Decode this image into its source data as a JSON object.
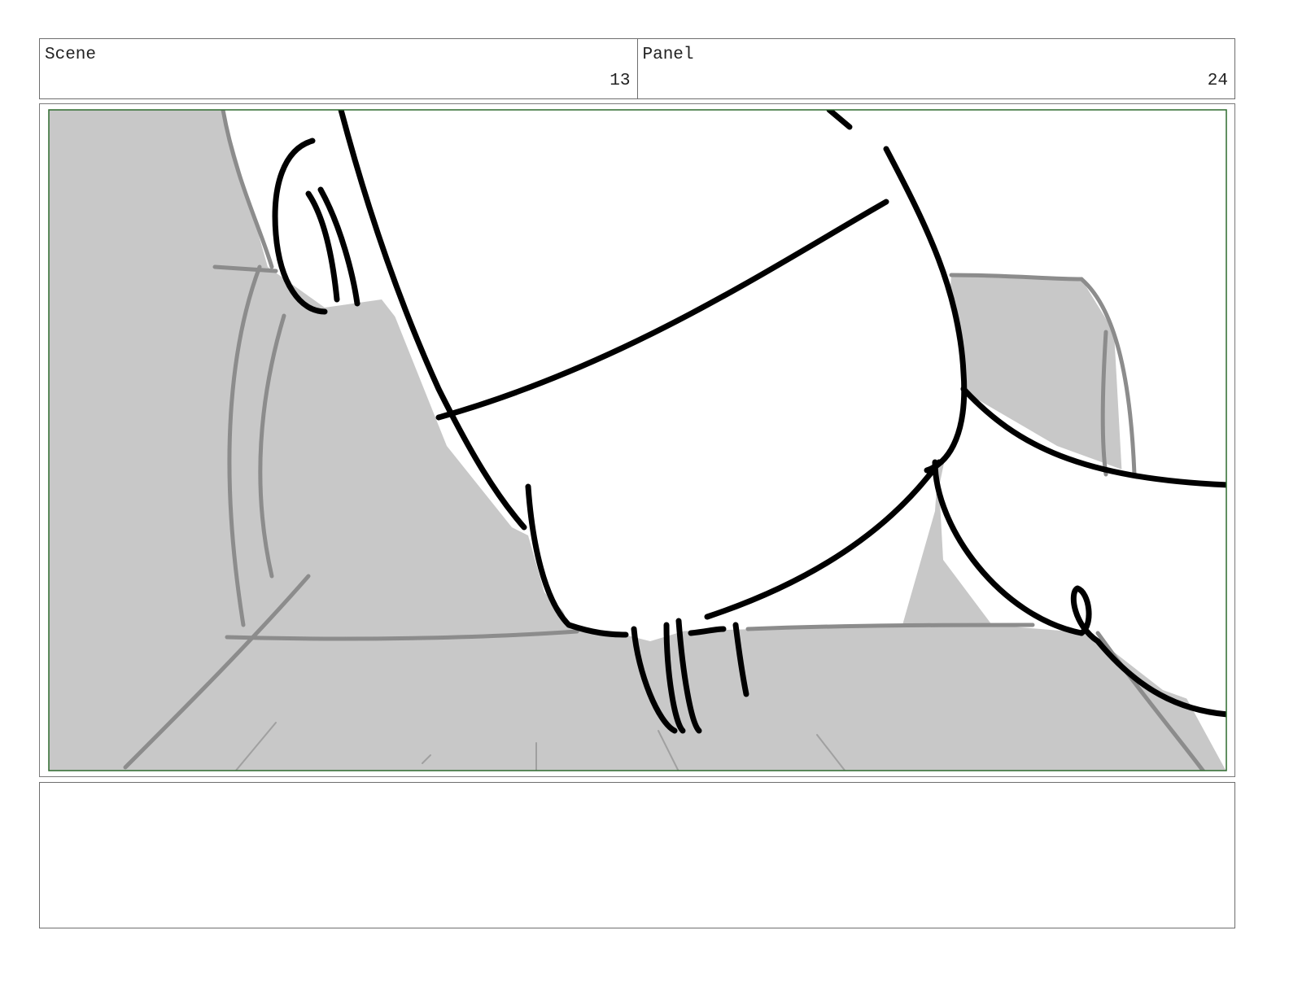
{
  "header": {
    "scene_label": "Scene",
    "scene_number": "13",
    "panel_label": "Panel",
    "panel_number": "24"
  },
  "colors": {
    "safe_frame": "#2e6b2e",
    "shadow_fill": "#c8c8c8",
    "sketch_gray": "#8c8c8c",
    "ink": "#000000"
  },
  "notes": {
    "text": ""
  }
}
